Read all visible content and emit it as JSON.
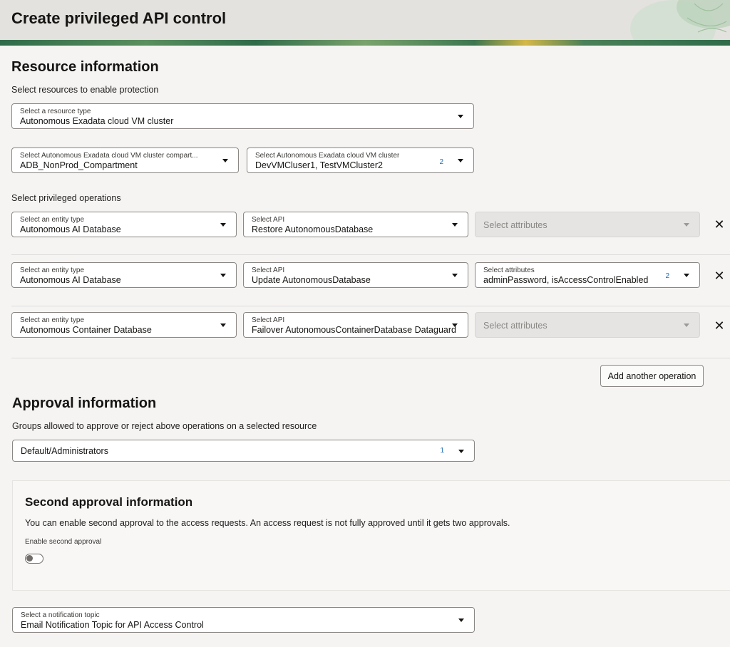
{
  "header": {
    "title": "Create privileged API control"
  },
  "resource": {
    "title": "Resource information",
    "helper": "Select resources to enable protection",
    "resource_type": {
      "label": "Select a resource type",
      "value": "Autonomous Exadata cloud VM cluster"
    },
    "compartment": {
      "label": "Select Autonomous Exadata cloud VM cluster compart...",
      "value": "ADB_NonProd_Compartment"
    },
    "cluster": {
      "label": "Select Autonomous Exadata cloud VM cluster",
      "value": "DevVMCluser1, TestVMCluster2",
      "count": "2"
    }
  },
  "operations": {
    "helper": "Select privileged operations",
    "rows": [
      {
        "entity": {
          "label": "Select an entity type",
          "value": "Autonomous AI Database"
        },
        "api": {
          "label": "Select API",
          "value": "Restore AutonomousDatabase"
        },
        "attributes": {
          "placeholder": "Select attributes",
          "disabled": true
        }
      },
      {
        "entity": {
          "label": "Select an entity type",
          "value": "Autonomous AI Database"
        },
        "api": {
          "label": "Select API",
          "value": "Update AutonomousDatabase"
        },
        "attributes": {
          "label": "Select attributes",
          "value": "adminPassword, isAccessControlEnabled",
          "count": "2"
        }
      },
      {
        "entity": {
          "label": "Select an entity type",
          "value": "Autonomous Container Database"
        },
        "api": {
          "label": "Select API",
          "value": "Failover AutonomousContainerDatabase Dataguard"
        },
        "attributes": {
          "placeholder": "Select attributes",
          "disabled": true
        }
      }
    ],
    "remove_icon": "close-icon",
    "add_button": "Add another operation"
  },
  "approval": {
    "title": "Approval information",
    "helper": "Groups allowed to approve or reject above operations on a selected resource",
    "groups": {
      "value": "Default/Administrators",
      "count": "1"
    },
    "second": {
      "title": "Second approval information",
      "text": "You can enable second approval to the access requests. An access request is not fully approved until it gets two approvals.",
      "toggle_label": "Enable second approval",
      "enabled": false
    },
    "notification": {
      "label": "Select a notification topic",
      "value": "Email Notification Topic for API Access Control"
    }
  },
  "colors": {
    "accent": "#1f6fb8",
    "header_band": "#2f6b4a",
    "background": "#f5f4f2"
  }
}
